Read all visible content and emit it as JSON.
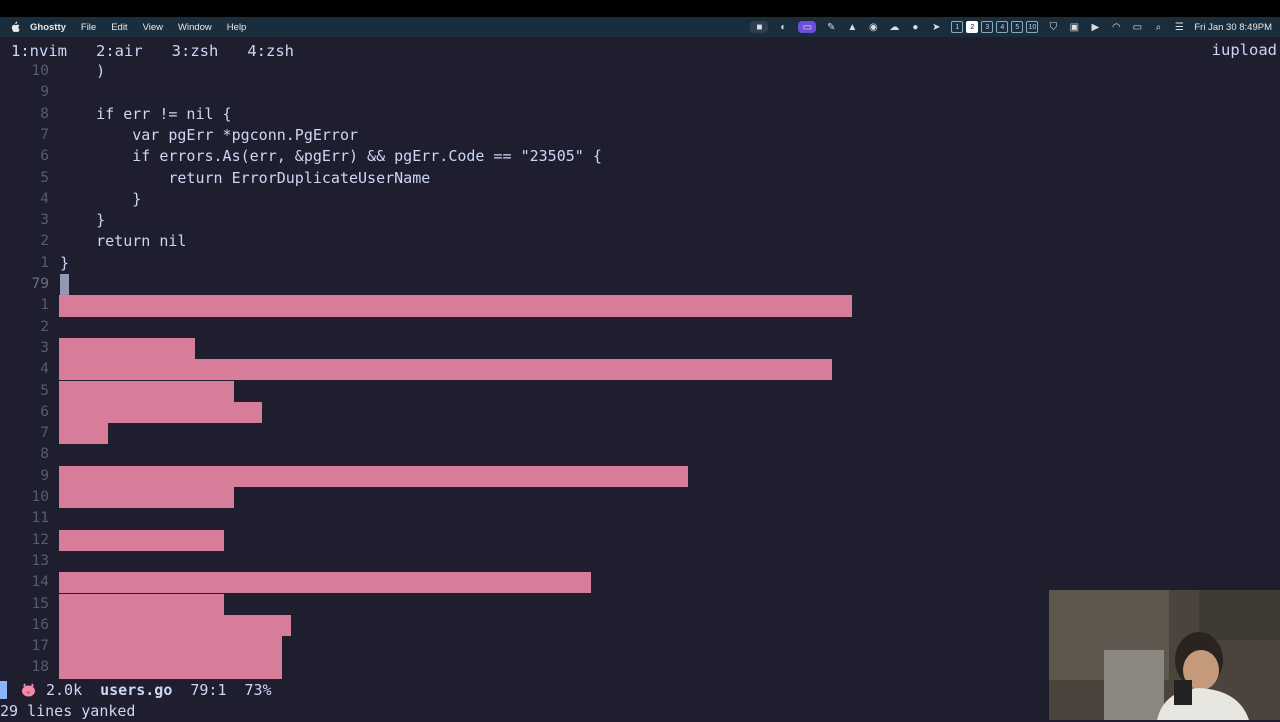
{
  "menubar": {
    "app": "Ghostty",
    "menus": [
      "File",
      "Edit",
      "View",
      "Window",
      "Help"
    ],
    "status_icons": [
      "video-icon",
      "sync-icon",
      "screen-record-icon",
      "pen-icon",
      "triangle-icon",
      "compass-icon",
      "cloud-icon",
      "zoom-icon",
      "pointer-icon",
      "shield-icon",
      "window-icon",
      "play-icon",
      "wifi-icon",
      "battery-icon",
      "search-icon",
      "control-center-icon"
    ],
    "spaces": [
      "1",
      "2",
      "3",
      "4",
      "5",
      "10"
    ],
    "active_space": "2",
    "clock": "Fri Jan 30  8:49PM"
  },
  "tmux": {
    "tabs": [
      "1:nvim",
      "2:air",
      "3:zsh",
      "4:zsh"
    ],
    "session": "iupload"
  },
  "editor": {
    "lines": [
      {
        "nr": "10",
        "text": "    )"
      },
      {
        "nr": "9",
        "text": ""
      },
      {
        "nr": "8",
        "text": "    if err != nil {"
      },
      {
        "nr": "7",
        "text": "        var pgErr *pgconn.PgError"
      },
      {
        "nr": "6",
        "text": "        if errors.As(err, &pgErr) && pgErr.Code == \"23505\" {"
      },
      {
        "nr": "5",
        "text": "            return ErrorDuplicateUserName"
      },
      {
        "nr": "4",
        "text": "        }"
      },
      {
        "nr": "3",
        "text": "    }"
      },
      {
        "nr": "2",
        "text": "    return nil"
      },
      {
        "nr": "1",
        "text": "}"
      },
      {
        "nr": "79",
        "text": ""
      },
      {
        "nr": "1",
        "text": ""
      },
      {
        "nr": "2",
        "text": ""
      },
      {
        "nr": "3",
        "text": ""
      },
      {
        "nr": "4",
        "text": ""
      },
      {
        "nr": "5",
        "text": ""
      },
      {
        "nr": "6",
        "text": ""
      },
      {
        "nr": "7",
        "text": ""
      },
      {
        "nr": "8",
        "text": ""
      },
      {
        "nr": "9",
        "text": ""
      },
      {
        "nr": "10",
        "text": ""
      },
      {
        "nr": "11",
        "text": ""
      },
      {
        "nr": "12",
        "text": ""
      },
      {
        "nr": "13",
        "text": ""
      },
      {
        "nr": "14",
        "text": ""
      },
      {
        "nr": "15",
        "text": ""
      },
      {
        "nr": "16",
        "text": ""
      },
      {
        "nr": "17",
        "text": ""
      },
      {
        "nr": "18",
        "text": ""
      }
    ],
    "highlight_color": "#f38ba8"
  },
  "statusline": {
    "size": "2.0k",
    "filename": "users.go",
    "position": "79:1",
    "percent": "73%"
  },
  "cmdline": "29 lines yanked"
}
